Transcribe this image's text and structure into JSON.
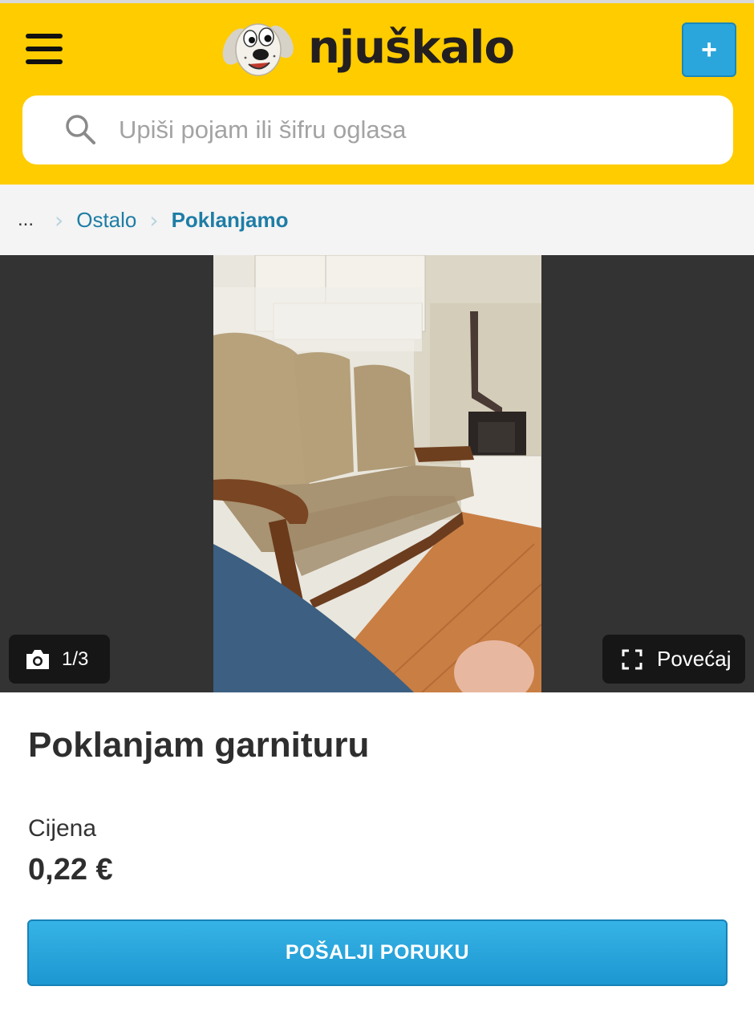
{
  "header": {
    "logo_text": "njuškalo",
    "add_label": "+",
    "brand_color": "#ffcc00",
    "accent_color": "#2aa6dc"
  },
  "search": {
    "placeholder": "Upiši pojam ili šifru oglasa",
    "value": ""
  },
  "breadcrumb": {
    "ellipsis": "...",
    "items": [
      {
        "label": "Ostalo"
      },
      {
        "label": "Poklanjamo"
      }
    ]
  },
  "gallery": {
    "counter": "1/3",
    "enlarge_label": "Povećaj"
  },
  "listing": {
    "title": "Poklanjam garnituru",
    "price_label": "Cijena",
    "price_value": "0,22 €"
  },
  "actions": {
    "send_message_label": "POŠALJI PORUKU"
  }
}
